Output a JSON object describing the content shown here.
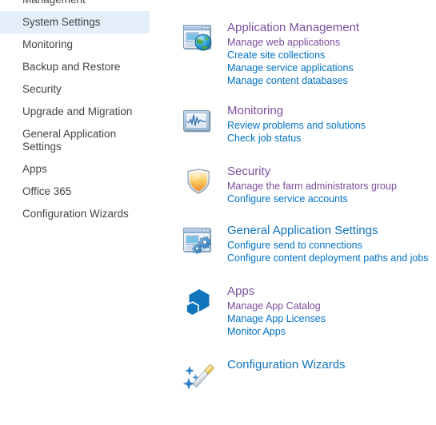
{
  "sidebar": {
    "items": [
      {
        "label": "Management",
        "clipped": true,
        "selected": false,
        "wrapped": false
      },
      {
        "label": "System Settings",
        "clipped": false,
        "selected": true,
        "wrapped": false
      },
      {
        "label": "Monitoring",
        "clipped": false,
        "selected": false,
        "wrapped": false
      },
      {
        "label": "Backup and Restore",
        "clipped": false,
        "selected": false,
        "wrapped": false
      },
      {
        "label": "Security",
        "clipped": false,
        "selected": false,
        "wrapped": false
      },
      {
        "label": "Upgrade and Migration",
        "clipped": false,
        "selected": false,
        "wrapped": false
      },
      {
        "label": "General Application Settings",
        "clipped": false,
        "selected": false,
        "wrapped": true
      },
      {
        "label": "Apps",
        "clipped": false,
        "selected": false,
        "wrapped": false
      },
      {
        "label": "Office 365",
        "clipped": false,
        "selected": false,
        "wrapped": false
      },
      {
        "label": "Configuration Wizards",
        "clipped": false,
        "selected": false,
        "wrapped": false
      }
    ]
  },
  "main": {
    "sections": [
      {
        "id": "sec-appmgmt",
        "icon": "window-globe-icon",
        "title": "Application Management",
        "title_visited": true,
        "links": [
          {
            "label": "Manage web applications",
            "visited": true
          },
          {
            "label": "Create site collections",
            "visited": false
          },
          {
            "label": "Manage service applications",
            "visited": false
          },
          {
            "label": "Manage content databases",
            "visited": false
          }
        ]
      },
      {
        "id": "sec-monitoring",
        "icon": "monitor-chart-icon",
        "title": "Monitoring",
        "title_visited": true,
        "links": [
          {
            "label": "Review problems and solutions",
            "visited": false
          },
          {
            "label": "Check job status",
            "visited": false
          }
        ]
      },
      {
        "id": "sec-security",
        "icon": "shield-icon",
        "title": "Security",
        "title_visited": true,
        "links": [
          {
            "label": "Manage the farm administrators group",
            "visited": true
          },
          {
            "label": "Configure service accounts",
            "visited": false
          }
        ]
      },
      {
        "id": "sec-gensettings",
        "icon": "window-gears-icon",
        "title": "General Application Settings",
        "title_visited": false,
        "links": [
          {
            "label": "Configure send to connections",
            "visited": false
          },
          {
            "label": "Configure content deployment paths and jobs",
            "visited": false
          }
        ]
      },
      {
        "id": "sec-apps",
        "icon": "hexagon-cube-icon",
        "title": "Apps",
        "title_visited": true,
        "links": [
          {
            "label": "Manage App Catalog",
            "visited": true
          },
          {
            "label": "Manage App Licenses",
            "visited": false
          },
          {
            "label": "Monitor Apps",
            "visited": false
          }
        ]
      },
      {
        "id": "sec-wizards",
        "icon": "magic-wand-icon",
        "title": "Configuration Wizards",
        "title_visited": false,
        "links": []
      }
    ]
  },
  "colors": {
    "link_blue": "#0072c6",
    "link_visited_purple": "#7b4f9d",
    "heading_blue": "#1073bd",
    "nav_selected_bg": "#e4eff9",
    "nav_text": "#444444"
  }
}
